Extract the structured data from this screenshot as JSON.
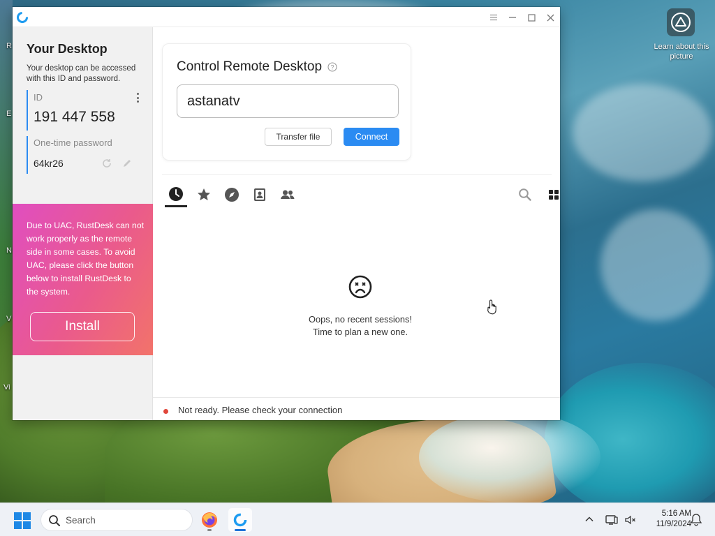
{
  "desktop": {
    "learn_icon_label": "Learn about this picture",
    "edge_icon_letters": [
      "R",
      "E",
      "N",
      "V",
      "Vi"
    ]
  },
  "window": {
    "title_icon": "rustdesk-logo-icon",
    "controls": [
      "menu-icon",
      "minimize-icon",
      "maximize-icon",
      "close-icon"
    ]
  },
  "left_panel": {
    "title": "Your Desktop",
    "description": "Your desktop can be accessed with this ID and password.",
    "id_label": "ID",
    "id_value": "191 447 558",
    "password_label": "One-time password",
    "password_value": "64kr26",
    "uac_text": "Due to UAC, RustDesk can not work properly as the remote side in some cases. To avoid UAC, please click the button below to install RustDesk to the system.",
    "install_label": "Install"
  },
  "connect": {
    "title": "Control Remote Desktop",
    "input_value": "astanatv",
    "transfer_label": "Transfer file",
    "connect_label": "Connect"
  },
  "tabs": {
    "items": [
      "recent-sessions-icon",
      "favorites-icon",
      "discovered-icon",
      "address-book-icon",
      "group-icon"
    ],
    "active": 0,
    "right_icons": [
      "search-icon",
      "grid-view-icon"
    ]
  },
  "empty_state": {
    "line1": "Oops, no recent sessions!",
    "line2": "Time to plan a new one."
  },
  "status": {
    "text": "Not ready. Please check your connection",
    "dot_color": "#e0463a"
  },
  "taskbar": {
    "search_label": "Search",
    "time": "5:16 AM",
    "date": "11/9/2024"
  },
  "colors": {
    "accent": "#2b8bf2",
    "uac_gradient_start": "#e04ec0",
    "uac_gradient_end": "#f2736a"
  }
}
